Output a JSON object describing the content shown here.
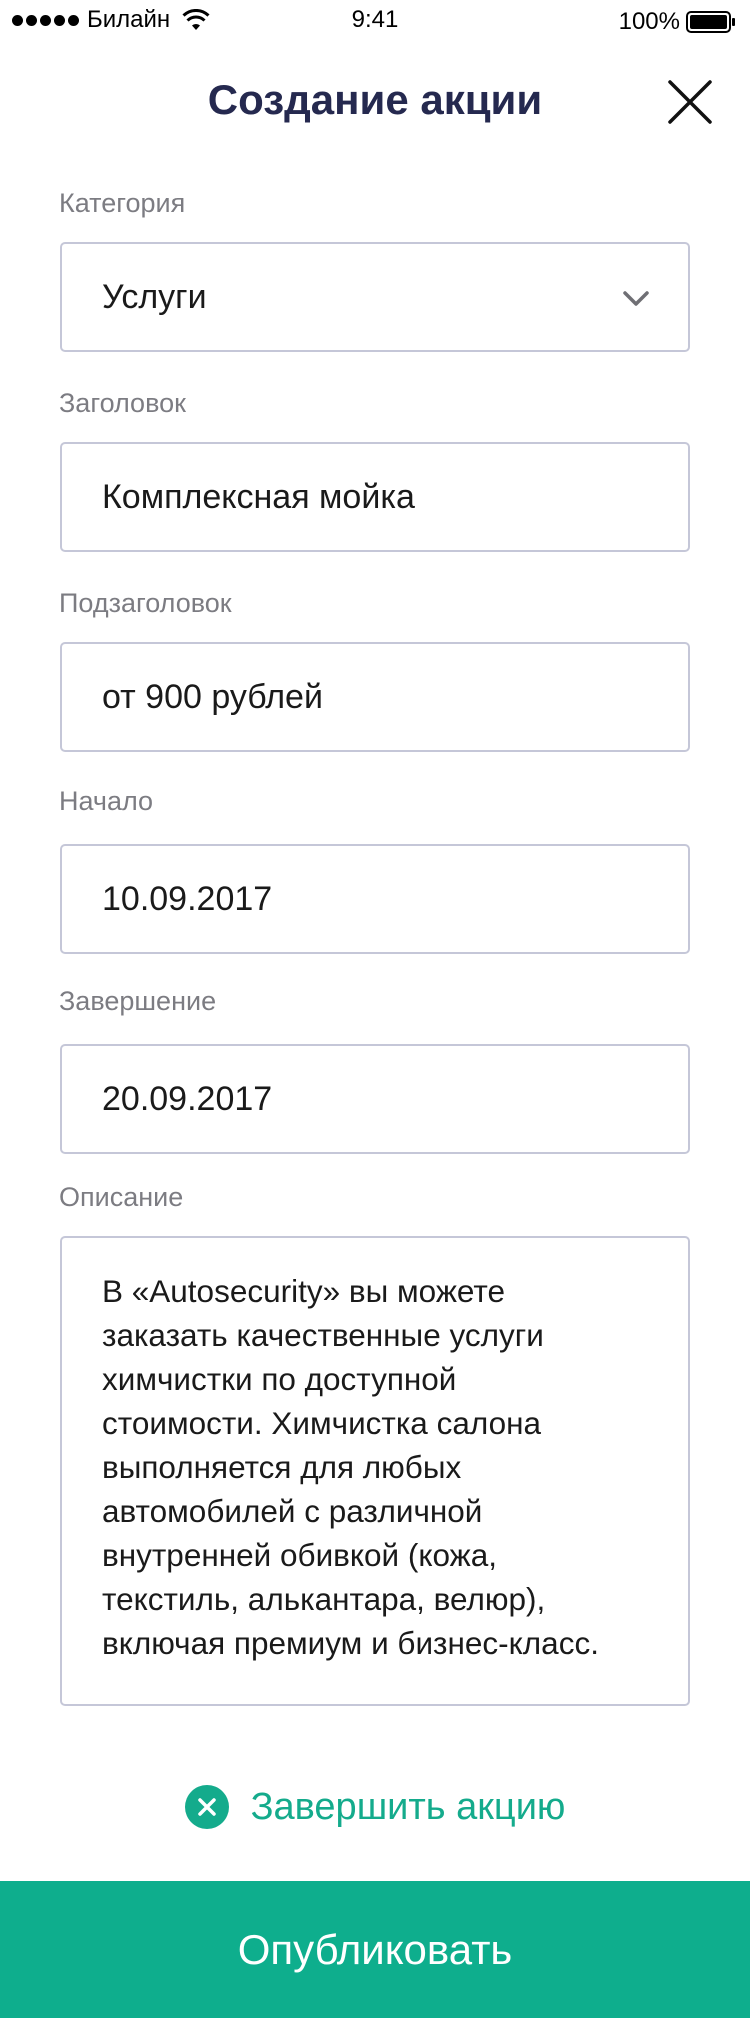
{
  "status_bar": {
    "carrier": "Билайн",
    "time": "9:41",
    "battery": "100%"
  },
  "header": {
    "title": "Создание акции"
  },
  "form": {
    "category": {
      "label": "Категория",
      "value": "Услуги"
    },
    "title": {
      "label": "Заголовок",
      "value": "Комплексная мойка"
    },
    "subtitle": {
      "label": "Подзаголовок",
      "value": "от 900 рублей"
    },
    "start": {
      "label": "Начало",
      "value": "10.09.2017"
    },
    "end": {
      "label": "Завершение",
      "value": "20.09.2017"
    },
    "description": {
      "label": "Описание",
      "value": "В «Autosecurity» вы можете\nзаказать качественные услуги\nхимчистки по доступной\nстоимости. Химчистка салона\nвыполняется для любых\nавтомобилей с различной\nвнутренней обивкой (кожа,\nтекстиль, алькантара, велюр),\nвключая премиум и бизнес-класс."
    }
  },
  "actions": {
    "end_promo": "Завершить акцию",
    "publish": "Опубликовать"
  },
  "colors": {
    "title": "#25294f",
    "accent": "#0eae8d",
    "label": "#7c7c82",
    "border": "#c5c7d8"
  },
  "icons": [
    "wifi-icon",
    "battery-icon",
    "close-icon",
    "chevron-down-icon",
    "close-circle-icon"
  ]
}
